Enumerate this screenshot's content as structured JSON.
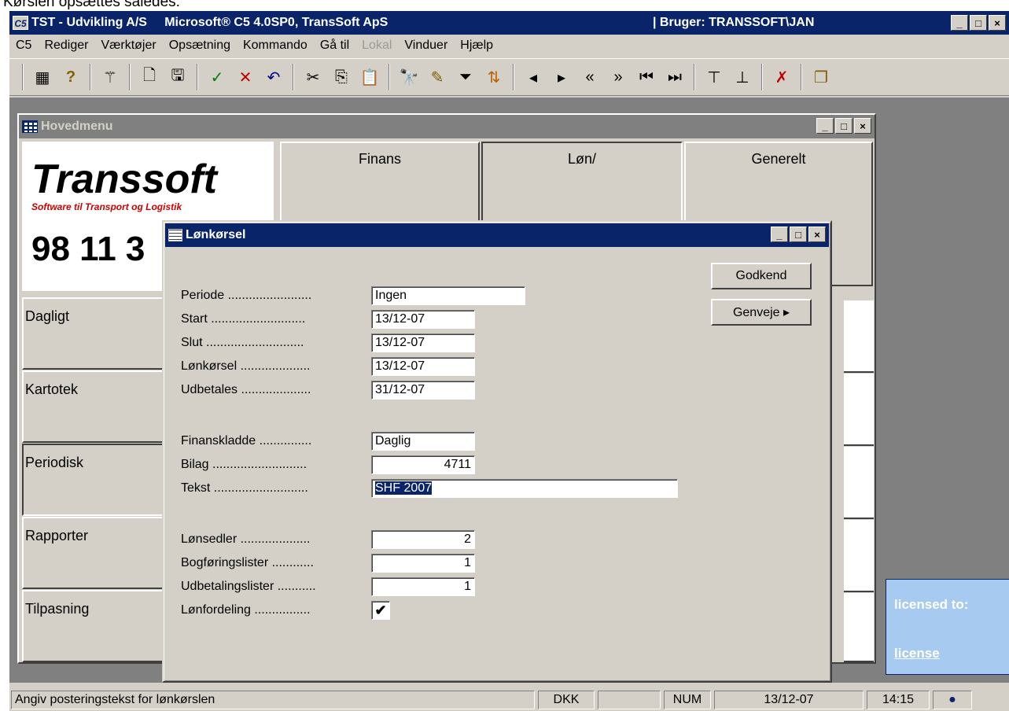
{
  "caption": "Kørslen opsættes således:",
  "app": {
    "logo": "C5",
    "title": "TST - Udvikling A/S     Microsoft® C5 4.0SP0, TransSoft ApS",
    "user": "| Bruger: TRANSSOFT\\JAN"
  },
  "menu": [
    "C5",
    "Rediger",
    "Værktøjer",
    "Opsætning",
    "Kommando",
    "Gå til",
    "Lokal",
    "Vinduer",
    "Hjælp"
  ],
  "window_buttons": {
    "minimize": "_",
    "maximize": "□",
    "close": "×"
  },
  "hovedmenu": {
    "title": "Hovedmenu",
    "brand": "Transsoft",
    "tagline": "Software til Transport og Logistik",
    "phone": "98 11 3",
    "side": [
      "Dagligt",
      "Kartotek",
      "Periodisk",
      "Rapporter",
      "Tilpasning"
    ],
    "tabs": [
      "Finans",
      "Løn/",
      "Generelt"
    ],
    "license_text": "licensed to:",
    "license_link": "license"
  },
  "dialog": {
    "title": "Lønkørsel",
    "fields": {
      "periode": {
        "label": "Periode ........................",
        "value": "Ingen"
      },
      "start": {
        "label": "Start ...........................",
        "value": "13/12-07"
      },
      "slut": {
        "label": "Slut ............................",
        "value": "13/12-07"
      },
      "lonkorsel": {
        "label": "Lønkørsel ....................",
        "value": "13/12-07"
      },
      "udbetales": {
        "label": "Udbetales ....................",
        "value": "31/12-07"
      },
      "finanskladde": {
        "label": "Finanskladde ...............",
        "value": "Daglig"
      },
      "bilag": {
        "label": "Bilag ...........................",
        "value": "4711"
      },
      "tekst": {
        "label": "Tekst ...........................",
        "value": "SHF 2007"
      },
      "lonsedler": {
        "label": "Lønsedler ....................",
        "value": "2"
      },
      "bogforingslister": {
        "label": "Bogføringslister ............",
        "value": "1"
      },
      "udbetalingslister": {
        "label": "Udbetalingslister ...........",
        "value": "1"
      },
      "lonfordeling": {
        "label": "Lønfordeling ................",
        "checked": "✔"
      }
    },
    "buttons": {
      "godkend": "Godkend",
      "genveje": "Genveje ▸"
    }
  },
  "statusbar": {
    "hint": "Angiv posteringstekst for lønkørslen",
    "currency": "DKK",
    "num": "NUM",
    "date": "13/12-07",
    "time": "14:15"
  }
}
